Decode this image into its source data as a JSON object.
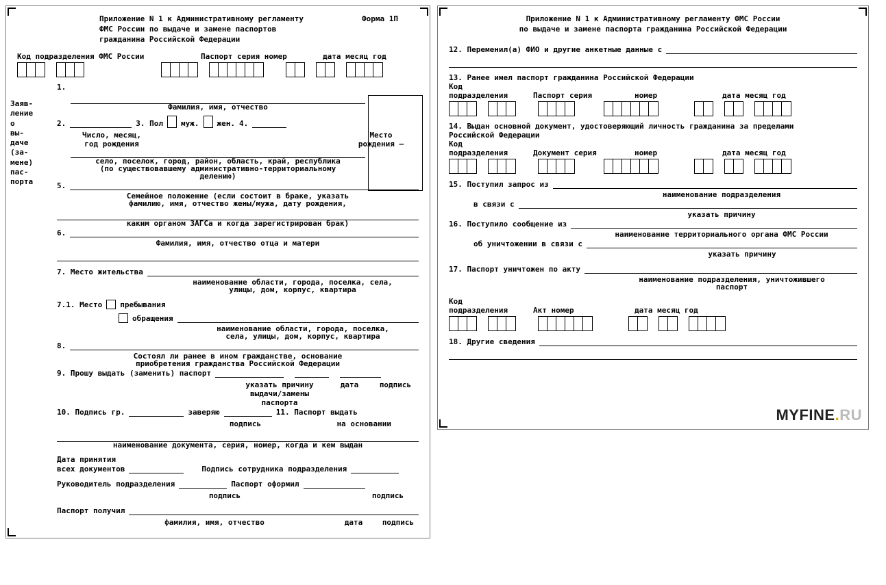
{
  "left": {
    "formNum": "Форма 1П",
    "hdr1": "Приложение N 1 к Административному регламенту",
    "hdr2": "ФМС России по выдаче и замене паспортов",
    "hdr3": "гражданина Российской Федерации",
    "labKod": "Код подразделения ФМС России",
    "labPass": "Паспорт серия номер",
    "labDate": "дата месяц год",
    "side": "Заяв-\nление\nо\nвы-\nдаче\n(за-\nмене)\nпас-\nпорта",
    "n1": "1.",
    "n1sub": "Фамилия, имя, отчество",
    "n2": "2.",
    "n2sub1": "Число, месяц,",
    "n2sub2": "год рождения",
    "n3": "3. Пол",
    "n3m": "муж.",
    "n3f": "жен.",
    "n4": "4.",
    "n4sub1": "Место",
    "n4sub2": "рождения –",
    "loc1": "село, поселок, город, район, область, край, республика",
    "loc2": "(по существовавшему административно-территориальному",
    "loc3": "делению)",
    "n5": "5.",
    "n5a": "Семейное положение (если состоит в браке, указать",
    "n5b": "фамилию, имя, отчество жены/мужа, дату рождения,",
    "n5c": "каким органом ЗАГСа и когда зарегистрирован брак)",
    "n6": "6.",
    "n6sub": "Фамилия, имя, отчество отца и матери",
    "n7": "7. Место жительства",
    "n7sub1": "наименование области, города, поселка, села,",
    "n7sub2": "улицы, дом, корпус, квартира",
    "n71a": "7.1. Место",
    "n71b": "пребывания",
    "n71c": "обращения",
    "n71sub1": "наименование области, города, поселка,",
    "n71sub2": "села, улицы, дом, корпус, квартира",
    "n8": "8.",
    "n8a": "Состоял ли ранее в ином гражданстве, основание",
    "n8b": "приобретения гражданства Российской Федерации",
    "n9": "9. Прошу выдать (заменить) паспорт",
    "n9sub1": "указать причину",
    "n9sub2": "выдачи/замены",
    "n9sub3": "паспорта",
    "n9d": "дата",
    "n9s": "подпись",
    "n10": "10. Подпись гр.",
    "n10z": "заверяю",
    "n10sub": "подпись",
    "n11": "11. Паспорт выдать",
    "n11sub": "на основании",
    "docline": "наименование документа, серия, номер, когда и кем выдан",
    "dp1": "Дата принятия",
    "dp2": "всех документов",
    "dps": "Подпись сотрудника подразделения",
    "ruk": "Руководитель подразделения",
    "pof": "Паспорт оформил",
    "pod": "подпись",
    "pp": "Паспорт получил",
    "ppsub": "фамилия, имя, отчество",
    "ppd": "дата",
    "pps": "подпись"
  },
  "right": {
    "hdr1": "Приложение N 1 к Административному регламенту ФМС России",
    "hdr2": "по выдаче и замене паспорта гражданина Российской Федерации",
    "n12": "12. Переменил(а) ФИО и другие анкетные данные с",
    "n13": "13. Ранее имел паспорт гражданина Российской Федерации",
    "kod": "Код",
    "kodp": "подразделения",
    "pass": "Паспорт серия",
    "nomer": "номер",
    "date": "дата месяц год",
    "n14": "14. Выдан основной документ, удостоверяющий личность гражданина за пределами",
    "n14b": "Российской Федерации",
    "docs": "Документ серия",
    "n15": "15. Поступил запрос из",
    "n15sub": "наименование подразделения",
    "n15b": "в связи с",
    "n15bsub": "указать причину",
    "n16": "16. Поступило сообщение из",
    "n16sub": "наименование территориального органа ФМС России",
    "n16b": "об уничтожении в связи с",
    "n16bsub": "указать причину",
    "n17": "17. Паспорт уничтожен по акту",
    "n17sub1": "наименование подразделения, уничтожившего",
    "n17sub2": "паспорт",
    "akt": "Акт номер",
    "n18": "18. Другие сведения"
  },
  "watermark": {
    "a": "MYFINE",
    "b": ".",
    "c": "RU"
  }
}
